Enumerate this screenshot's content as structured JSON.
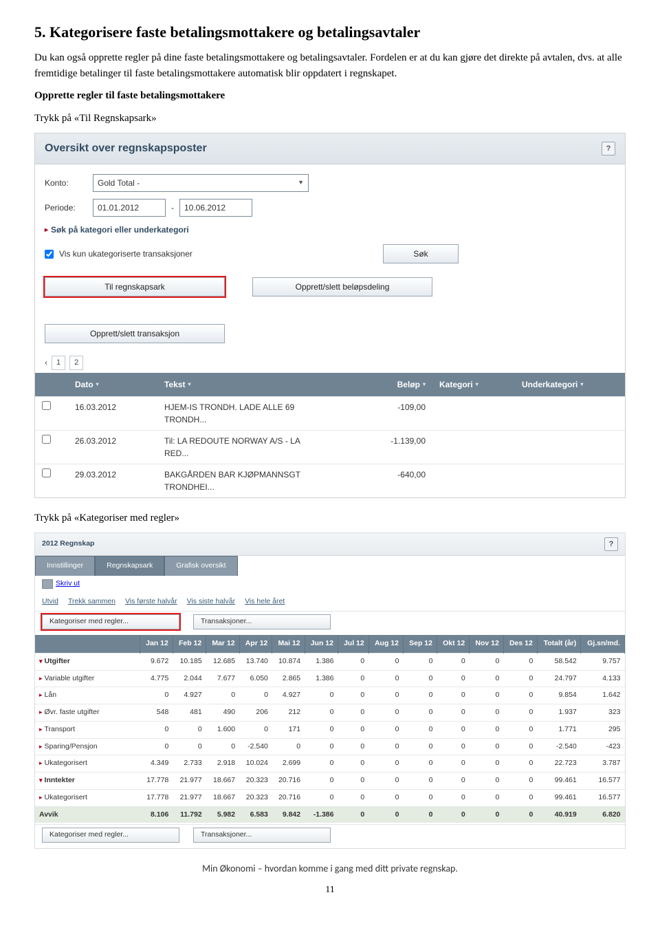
{
  "doc": {
    "heading": "5. Kategorisere faste betalingsmottakere og betalingsavtaler",
    "p1": "Du kan også opprette regler på dine faste betalingsmottakere og betalingsavtaler. Fordelen er at du kan gjøre det direkte på avtalen, dvs. at alle fremtidige betalinger til faste betalingsmottakere automatisk blir oppdatert i regnskapet.",
    "p2": "Opprette regler til faste betalingsmottakere",
    "p3": "Trykk på «Til Regnskapsark»",
    "p4": "Trykk på «Kategoriser med regler»",
    "footer": "Min Økonomi – hvordan komme i gang med ditt private regnskap.",
    "page": "11"
  },
  "s1": {
    "title": "Oversikt over regnskapsposter",
    "konto_lbl": "Konto:",
    "konto_val": "Gold Total -",
    "periode_lbl": "Periode:",
    "periode_from": "01.01.2012",
    "periode_to": "10.06.2012",
    "dash": "-",
    "search_expand": "Søk på kategori eller underkategori",
    "chk_lbl": "Vis kun ukategoriserte transaksjoner",
    "btn_search": "Søk",
    "btn_til": "Til regnskapsark",
    "btn_belop": "Opprett/slett beløpsdeling",
    "btn_trans": "Opprett/slett transaksjon",
    "pager_prev": "‹",
    "pager_1": "1",
    "pager_2": "2",
    "th_date": "Dato",
    "th_text": "Tekst",
    "th_amount": "Beløp",
    "th_cat": "Kategori",
    "th_sub": "Underkategori",
    "rows": [
      {
        "date": "16.03.2012",
        "text": "HJEM-IS TRONDH. LADE ALLE 69 TRONDH...",
        "amount": "-109,00"
      },
      {
        "date": "26.03.2012",
        "text": "Til: LA REDOUTE NORWAY A/S - LA RED...",
        "amount": "-1.139,00"
      },
      {
        "date": "29.03.2012",
        "text": "BAKGÅRDEN BAR KJØPMANNSGT TRONDHEI...",
        "amount": "-640,00"
      }
    ]
  },
  "s2": {
    "title": "2012 Regnskap",
    "tabs": [
      "Innstillinger",
      "Regnskapsark",
      "Grafisk oversikt"
    ],
    "print": "Skriv ut",
    "links": [
      "Utvid",
      "Trekk sammen",
      "Vis første halvår",
      "Vis siste halvår",
      "Vis hele året"
    ],
    "btn_kat": "Kategoriser med regler...",
    "btn_tr": "Transaksjoner...",
    "months": [
      "Jan 12",
      "Feb 12",
      "Mar 12",
      "Apr 12",
      "Mai 12",
      "Jun 12",
      "Jul 12",
      "Aug 12",
      "Sep 12",
      "Okt 12",
      "Nov 12",
      "Des 12",
      "Totalt (år)",
      "Gj.sn/md."
    ],
    "rows": [
      {
        "cls": "section",
        "tri": "▾",
        "lbl": "Utgifter",
        "v": [
          "9.672",
          "10.185",
          "12.685",
          "13.740",
          "10.874",
          "1.386",
          "0",
          "0",
          "0",
          "0",
          "0",
          "0",
          "58.542",
          "9.757"
        ]
      },
      {
        "cls": "",
        "tri": "▸",
        "lbl": "Variable utgifter",
        "v": [
          "4.775",
          "2.044",
          "7.677",
          "6.050",
          "2.865",
          "1.386",
          "0",
          "0",
          "0",
          "0",
          "0",
          "0",
          "24.797",
          "4.133"
        ]
      },
      {
        "cls": "",
        "tri": "▸",
        "lbl": "Lån",
        "v": [
          "0",
          "4.927",
          "0",
          "0",
          "4.927",
          "0",
          "0",
          "0",
          "0",
          "0",
          "0",
          "0",
          "9.854",
          "1.642"
        ]
      },
      {
        "cls": "",
        "tri": "▸",
        "lbl": "Øvr. faste utgifter",
        "v": [
          "548",
          "481",
          "490",
          "206",
          "212",
          "0",
          "0",
          "0",
          "0",
          "0",
          "0",
          "0",
          "1.937",
          "323"
        ]
      },
      {
        "cls": "",
        "tri": "▸",
        "lbl": "Transport",
        "v": [
          "0",
          "0",
          "1.600",
          "0",
          "171",
          "0",
          "0",
          "0",
          "0",
          "0",
          "0",
          "0",
          "1.771",
          "295"
        ]
      },
      {
        "cls": "",
        "tri": "▸",
        "lbl": "Sparing/Pensjon",
        "v": [
          "0",
          "0",
          "0",
          "-2.540",
          "0",
          "0",
          "0",
          "0",
          "0",
          "0",
          "0",
          "0",
          "-2.540",
          "-423"
        ]
      },
      {
        "cls": "",
        "tri": "▸",
        "lbl": "Ukategorisert",
        "v": [
          "4.349",
          "2.733",
          "2.918",
          "10.024",
          "2.699",
          "0",
          "0",
          "0",
          "0",
          "0",
          "0",
          "0",
          "22.723",
          "3.787"
        ]
      },
      {
        "cls": "inntekter",
        "tri": "▾",
        "lbl": "Inntekter",
        "v": [
          "17.778",
          "21.977",
          "18.667",
          "20.323",
          "20.716",
          "0",
          "0",
          "0",
          "0",
          "0",
          "0",
          "0",
          "99.461",
          "16.577"
        ]
      },
      {
        "cls": "",
        "tri": "▸",
        "lbl": "Ukategorisert",
        "v": [
          "17.778",
          "21.977",
          "18.667",
          "20.323",
          "20.716",
          "0",
          "0",
          "0",
          "0",
          "0",
          "0",
          "0",
          "99.461",
          "16.577"
        ]
      },
      {
        "cls": "avvik",
        "tri": "",
        "lbl": "Avvik",
        "v": [
          "8.106",
          "11.792",
          "5.982",
          "6.583",
          "9.842",
          "-1.386",
          "0",
          "0",
          "0",
          "0",
          "0",
          "0",
          "40.919",
          "6.820"
        ]
      }
    ]
  }
}
